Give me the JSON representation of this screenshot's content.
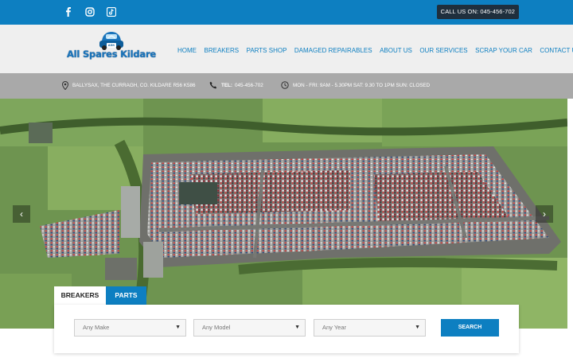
{
  "topbar": {
    "social": [
      {
        "name": "facebook-icon"
      },
      {
        "name": "instagram-icon"
      },
      {
        "name": "tiktok-icon"
      }
    ],
    "call_label": "CALL US ON: 045-456-702"
  },
  "header": {
    "logo_text": "All Spares Kildare",
    "logo_badge": "ASK",
    "nav": [
      {
        "label": "HOME"
      },
      {
        "label": "BREAKERS"
      },
      {
        "label": "PARTS SHOP"
      },
      {
        "label": "DAMAGED REPAIRABLES"
      },
      {
        "label": "ABOUT US"
      },
      {
        "label": "OUR SERVICES"
      },
      {
        "label": "SCRAP YOUR CAR"
      },
      {
        "label": "CONTACT US"
      }
    ]
  },
  "infobar": {
    "address": "BALLYSAX, THE CURRAGH, CO. KILDARE R56 K586",
    "tel_label": "TEL:",
    "tel_number": "045-456-702",
    "hours": "MON - FRI: 9AM - 5.30PM SAT: 9.30 TO 1PM SUN: CLOSED"
  },
  "hero": {
    "prev_label": "‹",
    "next_label": "›"
  },
  "search": {
    "tabs": [
      {
        "label": "BREAKERS"
      },
      {
        "label": "PARTS"
      }
    ],
    "make_placeholder": "Any Make",
    "model_placeholder": "Any Model",
    "year_placeholder": "Any Year",
    "button_label": "SEARCH"
  },
  "colors": {
    "brand_blue": "#0d7fc1",
    "dark": "#1f2f3d",
    "infobar_grey": "#a9a9a9"
  }
}
